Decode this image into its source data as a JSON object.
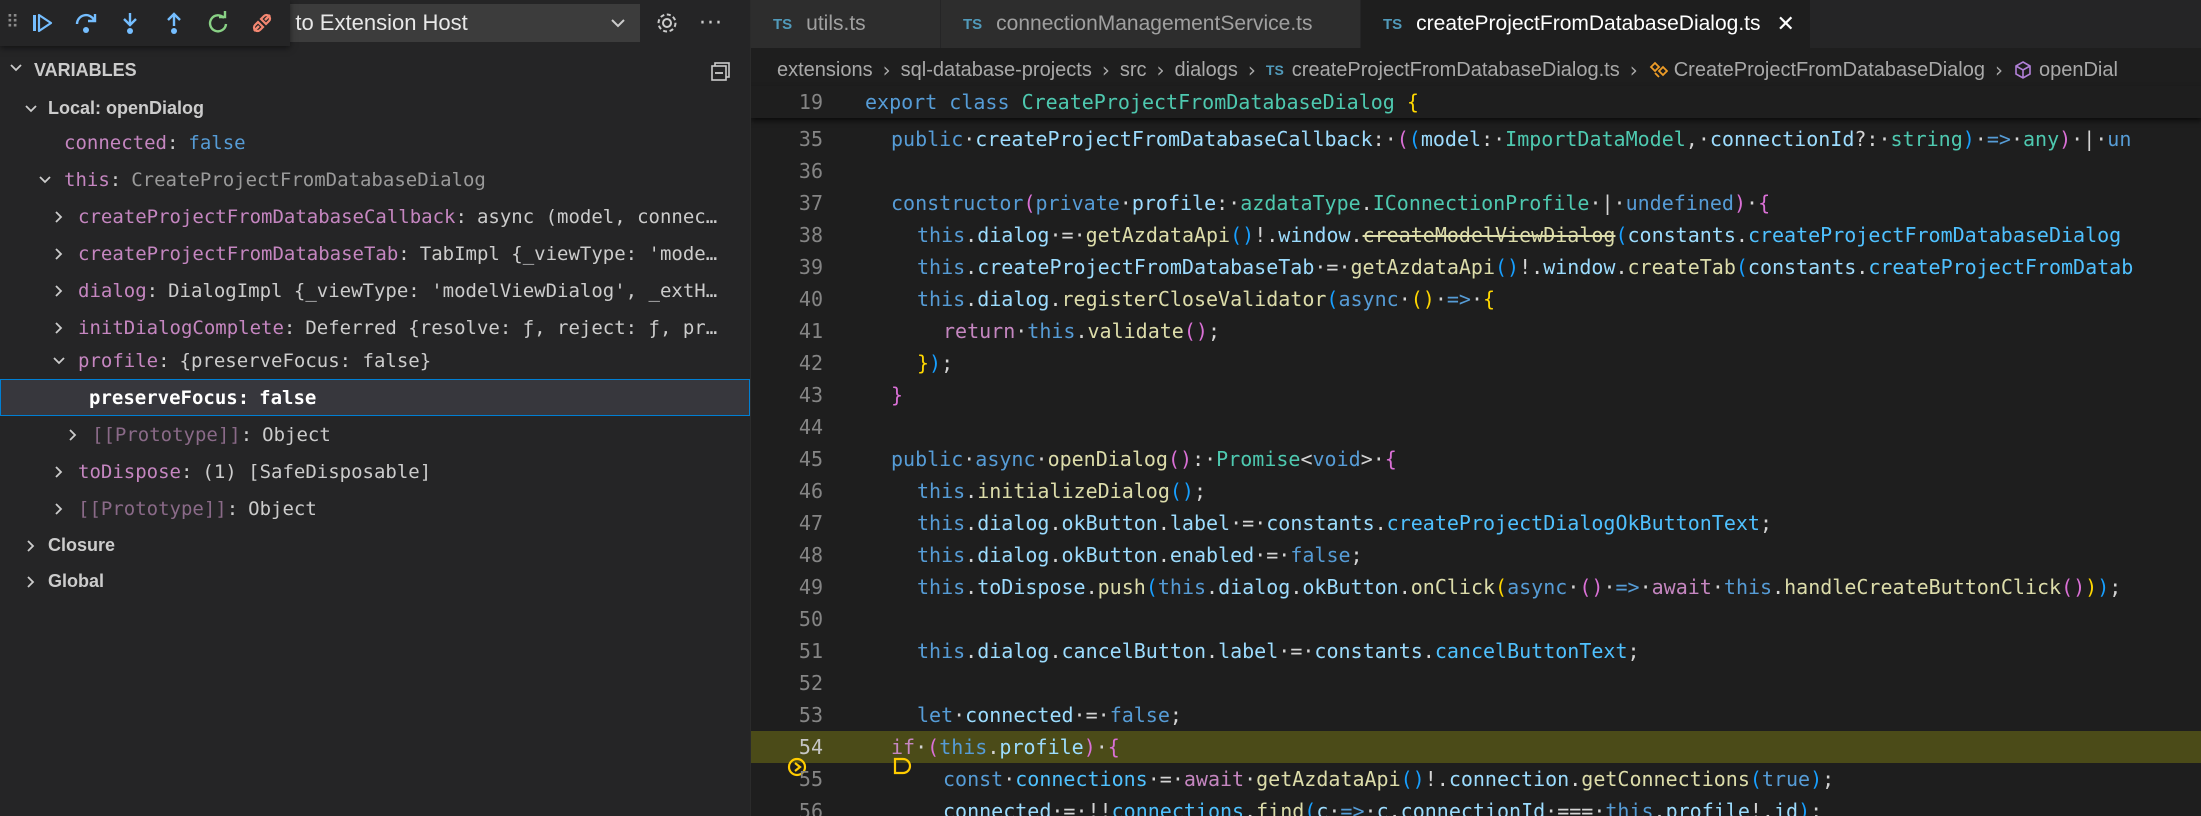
{
  "debug_toolbar": {
    "launch_config": "n to Extension Host",
    "buttons": [
      "continue-icon",
      "step-over-icon",
      "step-into-icon",
      "step-out-icon",
      "restart-icon",
      "disconnect-icon"
    ]
  },
  "variables": {
    "title": "VARIABLES",
    "rows": [
      {
        "kind": "scope",
        "label": "Local: openDialog"
      },
      {
        "name": "connected",
        "value": "false"
      },
      {
        "name": "this",
        "value": "CreateProjectFromDatabaseDialog"
      },
      {
        "name": "createProjectFromDatabaseCallback",
        "value": "async (model, connec…"
      },
      {
        "name": "createProjectFromDatabaseTab",
        "value": "TabImpl {_viewType: 'mode…"
      },
      {
        "name": "dialog",
        "value": "DialogImpl {_viewType: 'modelViewDialog', _extH…"
      },
      {
        "name": "initDialogComplete",
        "value": "Deferred {resolve: ƒ, reject: ƒ, pr…"
      },
      {
        "name": "profile",
        "value": "{preserveFocus: false}"
      },
      {
        "name": "preserveFocus",
        "value": "false"
      },
      {
        "name": "[[Prototype]]",
        "value": "Object"
      },
      {
        "name": "toDispose",
        "value": "(1) [SafeDisposable]"
      },
      {
        "name": "[[Prototype]]",
        "value": "Object"
      },
      {
        "kind": "scope",
        "label": "Closure"
      },
      {
        "kind": "scope",
        "label": "Global"
      }
    ]
  },
  "tabs": [
    {
      "icon": "TS",
      "label": "utils.ts"
    },
    {
      "icon": "TS",
      "label": "connectionManagementService.ts"
    },
    {
      "icon": "TS",
      "label": "createProjectFromDatabaseDialog.ts",
      "close": "✕"
    }
  ],
  "breadcrumb": {
    "parts": [
      "extensions",
      "sql-database-projects",
      "src",
      "dialogs"
    ],
    "file_icon": "TS",
    "file": "createProjectFromDatabaseDialog.ts",
    "class": "CreateProjectFromDatabaseDialog",
    "method": "openDial"
  },
  "editor": {
    "current_line": 54,
    "lines": [
      {
        "n": "19"
      },
      {
        "n": "35"
      },
      {
        "n": "36"
      },
      {
        "n": "37"
      },
      {
        "n": "38"
      },
      {
        "n": "39"
      },
      {
        "n": "40"
      },
      {
        "n": "41"
      },
      {
        "n": "42"
      },
      {
        "n": "43"
      },
      {
        "n": "44"
      },
      {
        "n": "45"
      },
      {
        "n": "46"
      },
      {
        "n": "47"
      },
      {
        "n": "48"
      },
      {
        "n": "49"
      },
      {
        "n": "50"
      },
      {
        "n": "51"
      },
      {
        "n": "52"
      },
      {
        "n": "53"
      },
      {
        "n": "54"
      },
      {
        "n": "55"
      },
      {
        "n": "56"
      }
    ],
    "tokens": {
      "export": "export",
      "class": "class",
      "className": "CreateProjectFromDatabaseDialog",
      "public": "public",
      "callbackName": "createProjectFromDatabaseCallback",
      "model": "model",
      "ImportDataModel": "ImportDataModel",
      "connectionId": "connectionId",
      "string": "string",
      "any": "any",
      "un": "un",
      "constructor": "constructor",
      "private": "private",
      "profile": "profile",
      "azdataType": "azdataType",
      "IConnectionProfile": "IConnectionProfile",
      "undefined": "undefined",
      "this": "this",
      "dialog": "dialog",
      "getAzdataApi": "getAzdataApi",
      "window": "window",
      "createModelViewDialog": "createModelViewDialog",
      "constants": "constants",
      "createProjectFromDatabaseDialog": "createProjectFromDatabaseDialog",
      "createProjectFromDatabaseTab": "createProjectFromDatabaseTab",
      "createTab": "createTab",
      "createProjectFromDatab": "createProjectFromDatab",
      "registerCloseValidator": "registerCloseValidator",
      "async": "async",
      "return": "return",
      "validate": "validate",
      "openDialog": "openDialog",
      "Promise": "Promise",
      "void": "void",
      "initializeDialog": "initializeDialog",
      "okButton": "okButton",
      "label": "label",
      "okText": "createProjectDialogOkButtonText",
      "enabled": "enabled",
      "false": "false",
      "toDispose": "toDispose",
      "push": "push",
      "onClick": "onClick",
      "await": "await",
      "handleCreateButtonClick": "handleCreateButtonClick",
      "cancelButton": "cancelButton",
      "cancelButtonText": "cancelButtonText",
      "let": "let",
      "connected": "connected",
      "if": "if",
      "const": "const",
      "connections": "connections",
      "connection": "connection",
      "getConnections": "getConnections",
      "true": "true",
      "find": "find",
      "c": "c",
      "id": "id"
    }
  }
}
